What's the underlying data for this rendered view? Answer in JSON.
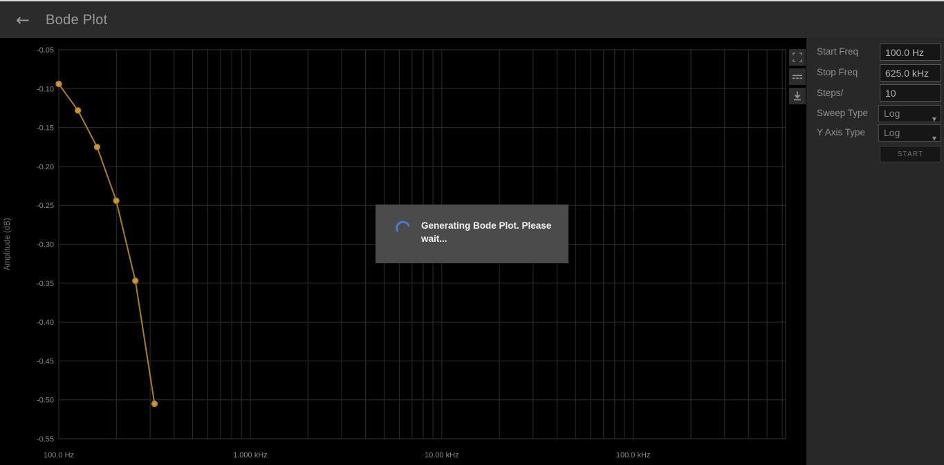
{
  "header": {
    "title": "Bode Plot",
    "back_icon": "←"
  },
  "chart_toolbar": {
    "buttons": [
      {
        "name": "fullscreen"
      },
      {
        "name": "series-visibility"
      },
      {
        "name": "download"
      }
    ]
  },
  "chart_data": {
    "type": "line",
    "x_scale": "log",
    "grid": true,
    "ylabel": "Amplitude (dB)",
    "x_range": [
      100,
      625000
    ],
    "y_range": [
      -0.55,
      -0.05
    ],
    "x_ticks": [
      {
        "value": 100,
        "label": "100.0 Hz"
      },
      {
        "value": 1000,
        "label": "1.000 kHz"
      },
      {
        "value": 10000,
        "label": "10.00 kHz"
      },
      {
        "value": 100000,
        "label": "100.0 kHz"
      }
    ],
    "y_ticks": [
      {
        "value": -0.05,
        "label": "-0.05"
      },
      {
        "value": -0.1,
        "label": "-0.10"
      },
      {
        "value": -0.15,
        "label": "-0.15"
      },
      {
        "value": -0.2,
        "label": "-0.20"
      },
      {
        "value": -0.25,
        "label": "-0.25"
      },
      {
        "value": -0.3,
        "label": "-0.30"
      },
      {
        "value": -0.35,
        "label": "-0.35"
      },
      {
        "value": -0.4,
        "label": "-0.40"
      },
      {
        "value": -0.45,
        "label": "-0.45"
      },
      {
        "value": -0.5,
        "label": "-0.50"
      },
      {
        "value": -0.55,
        "label": "-0.55"
      }
    ],
    "series": [
      {
        "name": "Amplitude (dB)",
        "color": "#ab7d24",
        "marker_color": "#c9953e",
        "points": [
          {
            "x": 100,
            "y": -0.094
          },
          {
            "x": 125.9,
            "y": -0.128
          },
          {
            "x": 158.5,
            "y": -0.175
          },
          {
            "x": 199.5,
            "y": -0.244
          },
          {
            "x": 251.2,
            "y": -0.347
          },
          {
            "x": 316.2,
            "y": -0.505
          }
        ]
      }
    ]
  },
  "modal": {
    "text": "Generating Bode Plot. Please wait...",
    "spinner_color": "#4a79d6"
  },
  "controls": {
    "rows": [
      {
        "label": "Start Freq",
        "value": "100.0 Hz",
        "type": "input"
      },
      {
        "label": "Stop Freq",
        "value": "625.0 kHz",
        "type": "input"
      },
      {
        "label": "Steps/",
        "value": "10",
        "type": "input"
      },
      {
        "label": "Sweep Type",
        "value": "Log",
        "type": "select"
      },
      {
        "label": "Y Axis Type",
        "value": "Log",
        "type": "select"
      }
    ],
    "start_button": "START"
  },
  "colors": {
    "header_bg": "#2b2b2b",
    "panel_bg": "#282828",
    "grid": "#2e2e2e",
    "trace": "#ab7d24",
    "spinner": "#4a79d6",
    "field_border": "#555555"
  }
}
